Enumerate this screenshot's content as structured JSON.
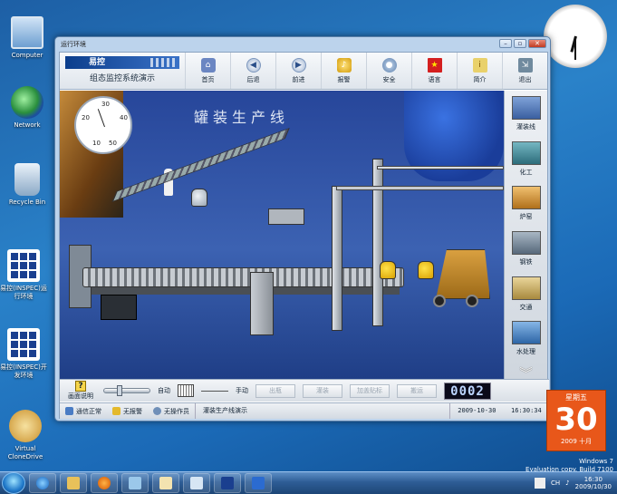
{
  "desktop": {
    "icons": [
      {
        "label": "Computer"
      },
      {
        "label": "Network"
      },
      {
        "label": "Recycle Bin"
      },
      {
        "label": "易控(INSPEC)运行环境"
      },
      {
        "label": "易控(INSPEC)开发环境"
      },
      {
        "label": "Virtual CloneDrive"
      }
    ],
    "calendar": {
      "weekday": "星期五",
      "day": "30",
      "year_month": "2009 十月"
    },
    "windows_note": {
      "line1": "Windows 7",
      "line2": "Evaluation copy. Build 7100"
    }
  },
  "window": {
    "title": "运行环境",
    "buttons": {
      "minimize": "–",
      "restore": "▫",
      "close": "✕"
    },
    "logo": {
      "brand": "易控",
      "subtitle": "组态监控系统演示"
    },
    "toolbar": [
      {
        "label": "首页",
        "icon": "home-icon",
        "glyph": "⌂"
      },
      {
        "label": "后退",
        "icon": "back-icon",
        "glyph": "◀"
      },
      {
        "label": "前进",
        "icon": "forward-icon",
        "glyph": "▶"
      },
      {
        "label": "报警",
        "icon": "alarm-icon",
        "glyph": "♪"
      },
      {
        "label": "安全",
        "icon": "security-icon",
        "glyph": "●"
      },
      {
        "label": "语言",
        "icon": "language-flag-icon",
        "glyph": "★"
      },
      {
        "label": "简介",
        "icon": "about-icon",
        "glyph": "i"
      },
      {
        "label": "退出",
        "icon": "exit-icon",
        "glyph": "⇲"
      }
    ],
    "scene": {
      "title": "罐装生产线",
      "gauge_ticks": {
        "t30": "30",
        "t20": "20",
        "t40": "40",
        "t10": "10",
        "t50": "50"
      }
    },
    "sidemenu": [
      {
        "label": "灌装线",
        "color": "#5a7dbf"
      },
      {
        "label": "化工",
        "color": "#3a8a9a"
      },
      {
        "label": "炉窑",
        "color": "#c9892b"
      },
      {
        "label": "钢铁",
        "color": "#7d8ea0"
      },
      {
        "label": "交通",
        "color": "#c7a253"
      },
      {
        "label": "水处理",
        "color": "#3f7ec1"
      }
    ],
    "controls": {
      "help_label": "画面说明",
      "auto_label": "自动",
      "manual_label": "手动",
      "buttons": [
        "出瓶",
        "灌装",
        "加盖贴标",
        "搬运"
      ],
      "counter": "0002"
    },
    "status": {
      "comm": "通信正常",
      "alarm": "无报警",
      "operator": "无操作员",
      "message": "灌装生产线演示",
      "date": "2009-10-30",
      "time": "16:30:34"
    }
  },
  "taskbar": {
    "tray": {
      "lang": "CH",
      "time": "16:30",
      "date": "2009/10/30"
    }
  }
}
